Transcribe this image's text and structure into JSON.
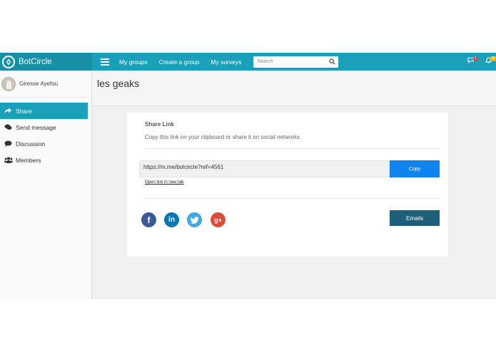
{
  "brand": {
    "name": "BotCircle"
  },
  "nav": {
    "items": [
      "My groups",
      "Create a group",
      "My surveys"
    ]
  },
  "search": {
    "placeholder": "Search"
  },
  "notifications": {
    "messages_count": "1",
    "alerts_count": "10"
  },
  "user": {
    "name": "Giresse Ayefou"
  },
  "sidebar": {
    "items": [
      {
        "label": "Share",
        "icon": "share-icon",
        "active": true
      },
      {
        "label": "Send message",
        "icon": "chat-icon"
      },
      {
        "label": "Discussion",
        "icon": "comment-icon"
      },
      {
        "label": "Members",
        "icon": "users-icon"
      }
    ]
  },
  "page": {
    "title": "les geaks"
  },
  "share": {
    "title": "Share Link",
    "description": "Copy this link on your clipboard or share it on social networks.",
    "link": "https://m.me/botcircle?ref=4561",
    "copy_label": "Copy",
    "open_new_tab_label": "Open link in new tab",
    "emails_label": "Emails",
    "social": [
      "facebook-icon",
      "linkedin-icon",
      "twitter-icon",
      "google-plus-icon"
    ]
  },
  "colors": {
    "topbar": "#1aa0b8",
    "brand_bg": "#1790a6",
    "copy_button": "#0d84f0",
    "emails_button": "#1d5f76",
    "facebook": "#3b5998",
    "linkedin": "#0a77b5",
    "twitter": "#3ea8e7",
    "google_plus": "#dd4b39"
  }
}
